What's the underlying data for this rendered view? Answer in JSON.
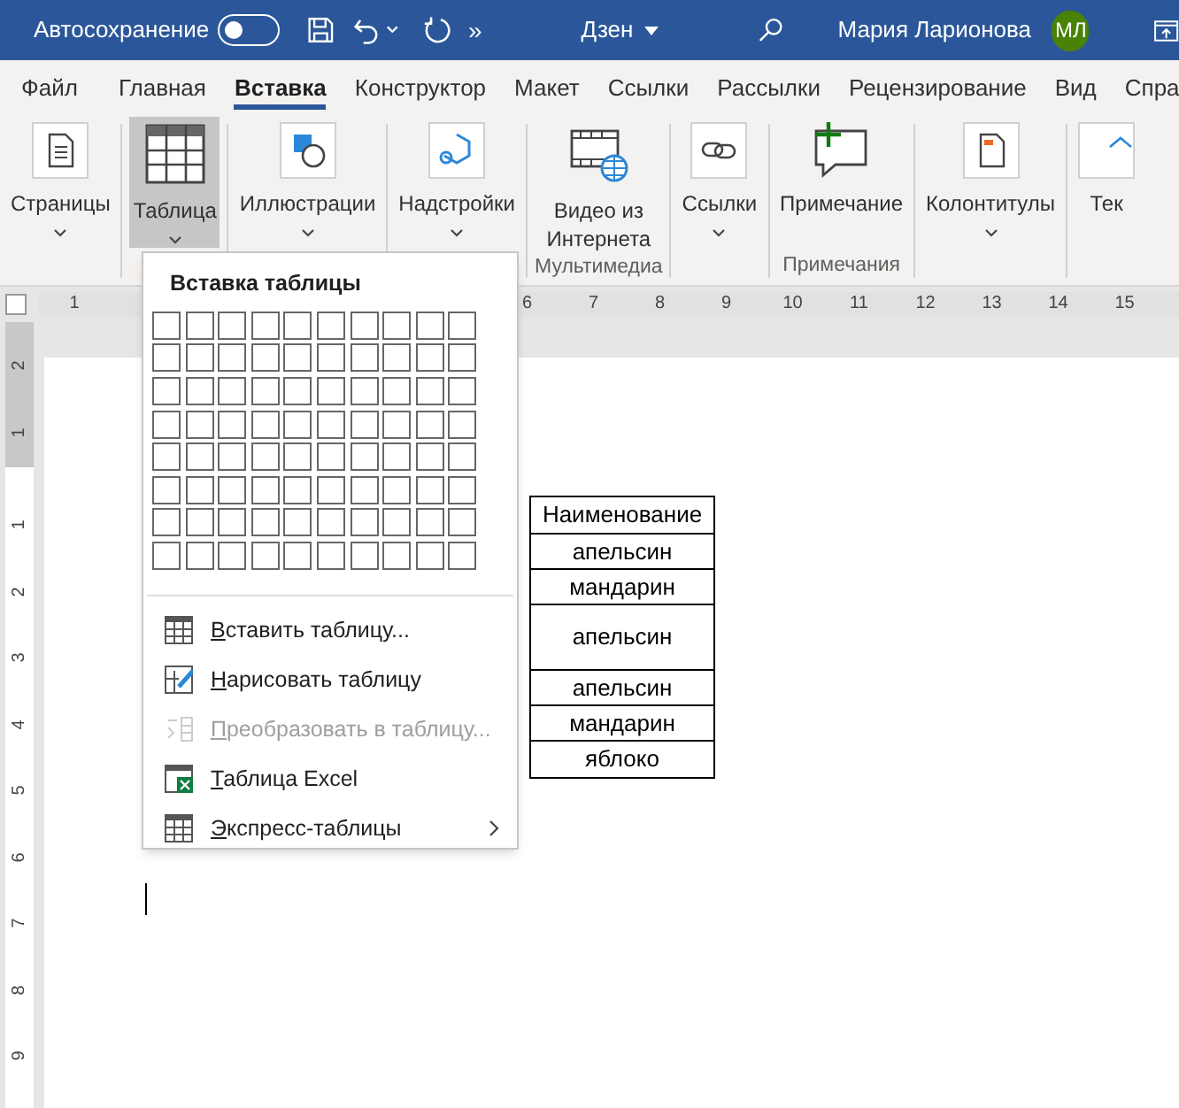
{
  "title_bar": {
    "autosave_label": "Автосохранение",
    "autosave_on": false,
    "overflow": "»",
    "document_name": "Дзен",
    "user_name": "Мария Ларионова",
    "user_initials": "МЛ"
  },
  "tabs": [
    {
      "label": "Файл",
      "selected": false
    },
    {
      "label": "Главная",
      "selected": false
    },
    {
      "label": "Вставка",
      "selected": true
    },
    {
      "label": "Конструктор",
      "selected": false
    },
    {
      "label": "Макет",
      "selected": false
    },
    {
      "label": "Ссылки",
      "selected": false
    },
    {
      "label": "Рассылки",
      "selected": false
    },
    {
      "label": "Рецензирование",
      "selected": false
    },
    {
      "label": "Вид",
      "selected": false
    },
    {
      "label": "Спра",
      "selected": false
    }
  ],
  "ribbon": {
    "groups": [
      {
        "buttons": [
          {
            "label": "Страницы",
            "kind": "pages",
            "dropdown": true,
            "selected": false
          }
        ]
      },
      {
        "buttons": [
          {
            "label": "Таблица",
            "kind": "table",
            "dropdown": true,
            "selected": true
          }
        ]
      },
      {
        "buttons": [
          {
            "label": "Иллюстрации",
            "kind": "shapes",
            "dropdown": true,
            "selected": false
          }
        ]
      },
      {
        "buttons": [
          {
            "label": "Надстройки",
            "kind": "addins",
            "dropdown": true,
            "selected": false
          }
        ]
      },
      {
        "label": "Мультимедиа",
        "buttons": [
          {
            "label": "Видео из Интернета",
            "kind": "video",
            "dropdown": false,
            "selected": false
          }
        ]
      },
      {
        "buttons": [
          {
            "label": "Ссылки",
            "kind": "links",
            "dropdown": true,
            "selected": false
          }
        ]
      },
      {
        "label": "Примечания",
        "buttons": [
          {
            "label": "Примечание",
            "kind": "comment",
            "dropdown": false,
            "selected": false
          }
        ]
      },
      {
        "buttons": [
          {
            "label": "Колонтитулы",
            "kind": "header",
            "dropdown": true,
            "selected": false
          }
        ]
      },
      {
        "buttons": [
          {
            "label": "Тек",
            "kind": "text",
            "dropdown": false,
            "selected": false
          }
        ]
      }
    ]
  },
  "horizontal_ruler": {
    "left_numbers": [
      "1"
    ],
    "right_numbers": [
      "6",
      "7",
      "8",
      "9",
      "10",
      "11",
      "12",
      "13",
      "14",
      "15"
    ]
  },
  "vertical_ruler": {
    "top_numbers": [
      "2",
      "1"
    ],
    "numbers": [
      "1",
      "2",
      "3",
      "4",
      "5",
      "6",
      "7",
      "8",
      "9"
    ]
  },
  "document": {
    "table_rows": [
      {
        "text": "Наименование",
        "tall": false
      },
      {
        "text": "апельсин",
        "tall": false
      },
      {
        "text": "мандарин",
        "tall": false
      },
      {
        "text": "апельсин",
        "tall": true
      },
      {
        "text": "апельсин",
        "tall": false
      },
      {
        "text": "мандарин",
        "tall": false
      },
      {
        "text": "яблоко",
        "tall": false
      }
    ]
  },
  "table_menu": {
    "title": "Вставка таблицы",
    "items": [
      {
        "label": "Вставить таблицу...",
        "kind": "insert",
        "disabled": false,
        "submenu": false
      },
      {
        "label": "Нарисовать таблицу",
        "kind": "draw",
        "disabled": false,
        "submenu": false
      },
      {
        "label": "Преобразовать в таблицу...",
        "kind": "convert",
        "disabled": true,
        "submenu": false
      },
      {
        "label": "Таблица Excel",
        "kind": "excel",
        "disabled": false,
        "submenu": false
      },
      {
        "label": "Экспресс-таблицы",
        "kind": "quick",
        "disabled": false,
        "submenu": true
      }
    ]
  }
}
